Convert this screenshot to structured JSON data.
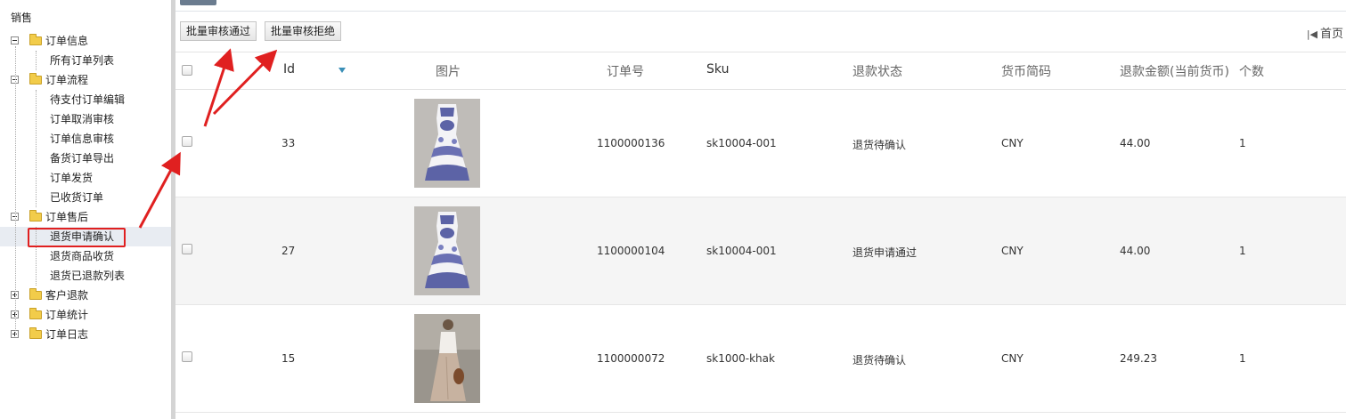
{
  "sidebar": {
    "title": "销售",
    "groups": [
      {
        "label": "订单信息",
        "expanded": true,
        "items": [
          "所有订单列表"
        ]
      },
      {
        "label": "订单流程",
        "expanded": true,
        "items": [
          "待支付订单编辑",
          "订单取消审核",
          "订单信息审核",
          "备货订单导出",
          "订单发货",
          "已收货订单"
        ]
      },
      {
        "label": "订单售后",
        "expanded": true,
        "items": [
          "退货申请确认",
          "退货商品收货",
          "退货已退款列表"
        ]
      },
      {
        "label": "客户退款",
        "expanded": false,
        "items": []
      },
      {
        "label": "订单统计",
        "expanded": false,
        "items": []
      },
      {
        "label": "订单日志",
        "expanded": false,
        "items": []
      }
    ],
    "selected_item": "退货申请确认"
  },
  "toolbar": {
    "approve_label": "批量审核通过",
    "reject_label": "批量审核拒绝",
    "first_page_label": "首页"
  },
  "table": {
    "columns": [
      "Id",
      "图片",
      "订单号",
      "Sku",
      "退款状态",
      "货币简码",
      "退款金额(当前货币)",
      "个数"
    ],
    "rows": [
      {
        "id": "33",
        "image": "blue-white-porcelain-print-dress",
        "order_no": "1100000136",
        "sku": "sk10004-001",
        "status": "退货待确认",
        "currency": "CNY",
        "amount": "44.00",
        "qty": "1"
      },
      {
        "id": "27",
        "image": "blue-white-porcelain-print-dress",
        "order_no": "1100000104",
        "sku": "sk10004-001",
        "status": "退货申请通过",
        "currency": "CNY",
        "amount": "44.00",
        "qty": "1"
      },
      {
        "id": "15",
        "image": "khaki-maxi-dress-backless",
        "order_no": "1100000072",
        "sku": "sk1000-khak",
        "status": "退货待确认",
        "currency": "CNY",
        "amount": "249.23",
        "qty": "1"
      }
    ]
  },
  "colors": {
    "annotation_red": "#e02020",
    "selected_row_bg": "#e8ecf2",
    "sort_icon": "#3a8fb7"
  }
}
